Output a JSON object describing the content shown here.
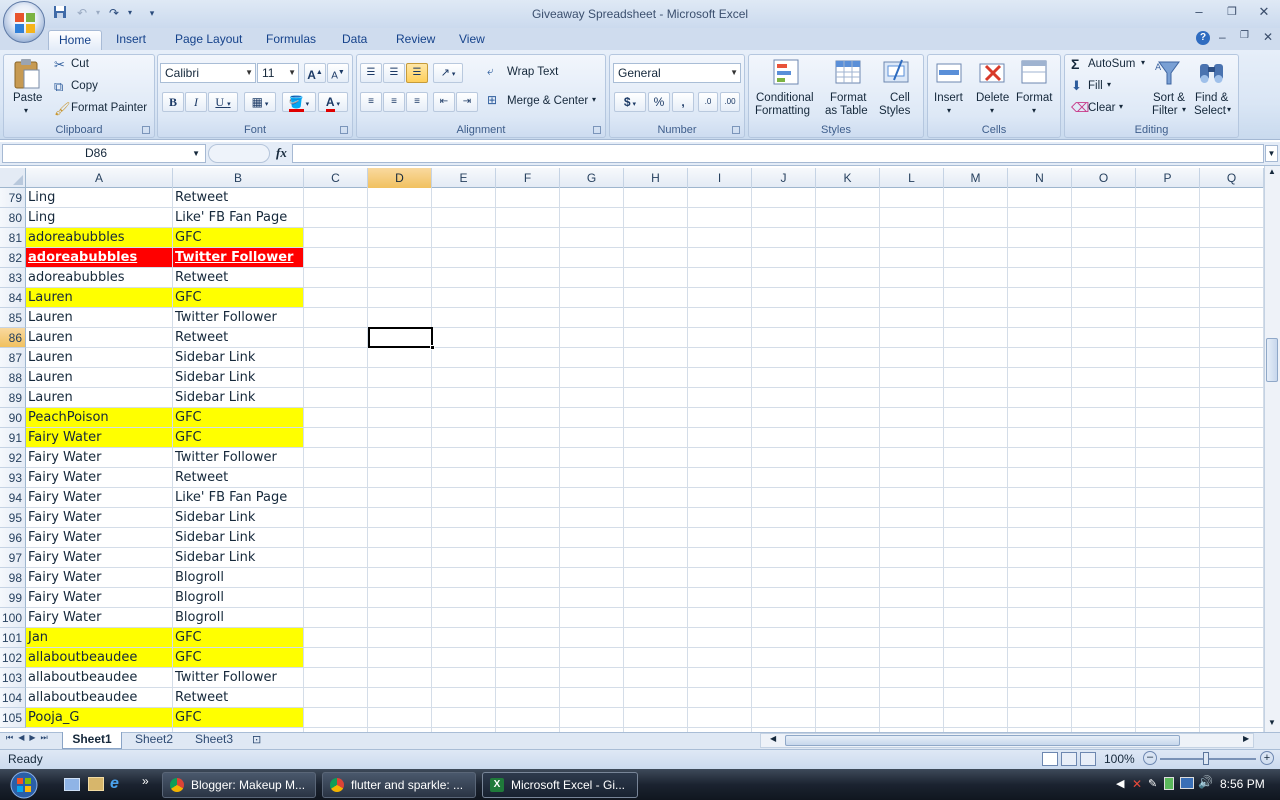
{
  "window": {
    "title": "Giveaway Spreadsheet - Microsoft Excel"
  },
  "ribbon": {
    "tabs": [
      "Home",
      "Insert",
      "Page Layout",
      "Formulas",
      "Data",
      "Review",
      "View"
    ],
    "clipboard": {
      "paste": "Paste",
      "cut": "Cut",
      "copy": "Copy",
      "format_painter": "Format Painter",
      "label": "Clipboard"
    },
    "font": {
      "name": "Calibri",
      "size": "11",
      "label": "Font"
    },
    "alignment": {
      "wrap": "Wrap Text",
      "merge": "Merge & Center",
      "label": "Alignment"
    },
    "number": {
      "format": "General",
      "label": "Number"
    },
    "styles": {
      "conditional_1": "Conditional",
      "conditional_2": "Formatting",
      "table_1": "Format",
      "table_2": "as Table",
      "cell_1": "Cell",
      "cell_2": "Styles",
      "label": "Styles"
    },
    "cells": {
      "insert": "Insert",
      "delete": "Delete",
      "format": "Format",
      "label": "Cells"
    },
    "editing": {
      "autosum": "AutoSum",
      "fill": "Fill",
      "clear": "Clear",
      "sort_1": "Sort &",
      "sort_2": "Filter",
      "find_1": "Find &",
      "find_2": "Select",
      "label": "Editing"
    }
  },
  "formula_bar": {
    "name_box": "D86",
    "fx": "fx",
    "value": ""
  },
  "grid": {
    "columns": [
      "A",
      "B",
      "C",
      "D",
      "E",
      "F",
      "G",
      "H",
      "I",
      "J",
      "K",
      "L",
      "M",
      "N",
      "O",
      "P",
      "Q"
    ],
    "selected_column": "D",
    "selected_row": "86",
    "rows": [
      {
        "num": "79",
        "a": "Ling",
        "b": "Retweet",
        "fill": "none"
      },
      {
        "num": "80",
        "a": "Ling",
        "b": "Like' FB Fan Page",
        "fill": "none"
      },
      {
        "num": "81",
        "a": "adoreabubbles",
        "b": "GFC",
        "fill": "yellow"
      },
      {
        "num": "82",
        "a": "adoreabubbles",
        "b": "Twitter Follower",
        "fill": "red"
      },
      {
        "num": "83",
        "a": "adoreabubbles",
        "b": "Retweet",
        "fill": "none"
      },
      {
        "num": "84",
        "a": "Lauren",
        "b": "GFC",
        "fill": "yellow"
      },
      {
        "num": "85",
        "a": "Lauren",
        "b": "Twitter Follower",
        "fill": "none"
      },
      {
        "num": "86",
        "a": "Lauren",
        "b": "Retweet",
        "fill": "none"
      },
      {
        "num": "87",
        "a": "Lauren",
        "b": "Sidebar Link",
        "fill": "none"
      },
      {
        "num": "88",
        "a": "Lauren",
        "b": "Sidebar Link",
        "fill": "none"
      },
      {
        "num": "89",
        "a": "Lauren",
        "b": "Sidebar Link",
        "fill": "none"
      },
      {
        "num": "90",
        "a": "PeachPoison",
        "b": "GFC",
        "fill": "yellow"
      },
      {
        "num": "91",
        "a": "Fairy Water",
        "b": "GFC",
        "fill": "yellow"
      },
      {
        "num": "92",
        "a": "Fairy Water",
        "b": "Twitter Follower",
        "fill": "none"
      },
      {
        "num": "93",
        "a": "Fairy Water",
        "b": "Retweet",
        "fill": "none"
      },
      {
        "num": "94",
        "a": "Fairy Water",
        "b": "Like' FB Fan Page",
        "fill": "none"
      },
      {
        "num": "95",
        "a": "Fairy Water",
        "b": "Sidebar Link",
        "fill": "none"
      },
      {
        "num": "96",
        "a": "Fairy Water",
        "b": "Sidebar Link",
        "fill": "none"
      },
      {
        "num": "97",
        "a": "Fairy Water",
        "b": "Sidebar Link",
        "fill": "none"
      },
      {
        "num": "98",
        "a": "Fairy Water",
        "b": "Blogroll",
        "fill": "none"
      },
      {
        "num": "99",
        "a": "Fairy Water",
        "b": "Blogroll",
        "fill": "none"
      },
      {
        "num": "100",
        "a": "Fairy Water",
        "b": "Blogroll",
        "fill": "none"
      },
      {
        "num": "101",
        "a": "Jan",
        "b": "GFC",
        "fill": "yellow"
      },
      {
        "num": "102",
        "a": "allaboutbeaudee",
        "b": "GFC",
        "fill": "yellow"
      },
      {
        "num": "103",
        "a": "allaboutbeaudee",
        "b": "Twitter Follower",
        "fill": "none"
      },
      {
        "num": "104",
        "a": "allaboutbeaudee",
        "b": "Retweet",
        "fill": "none"
      },
      {
        "num": "105",
        "a": "Pooja_G",
        "b": "GFC",
        "fill": "yellow"
      }
    ]
  },
  "sheets": [
    "Sheet1",
    "Sheet2",
    "Sheet3"
  ],
  "status": {
    "mode": "Ready",
    "zoom": "100%"
  },
  "taskbar": {
    "items": [
      {
        "label": "Blogger: Makeup M...",
        "icon": "chrome-icon"
      },
      {
        "label": "flutter and sparkle: ...",
        "icon": "chrome-icon"
      },
      {
        "label": "Microsoft Excel - Gi...",
        "icon": "excel-icon"
      }
    ],
    "clock": "8:56 PM"
  }
}
